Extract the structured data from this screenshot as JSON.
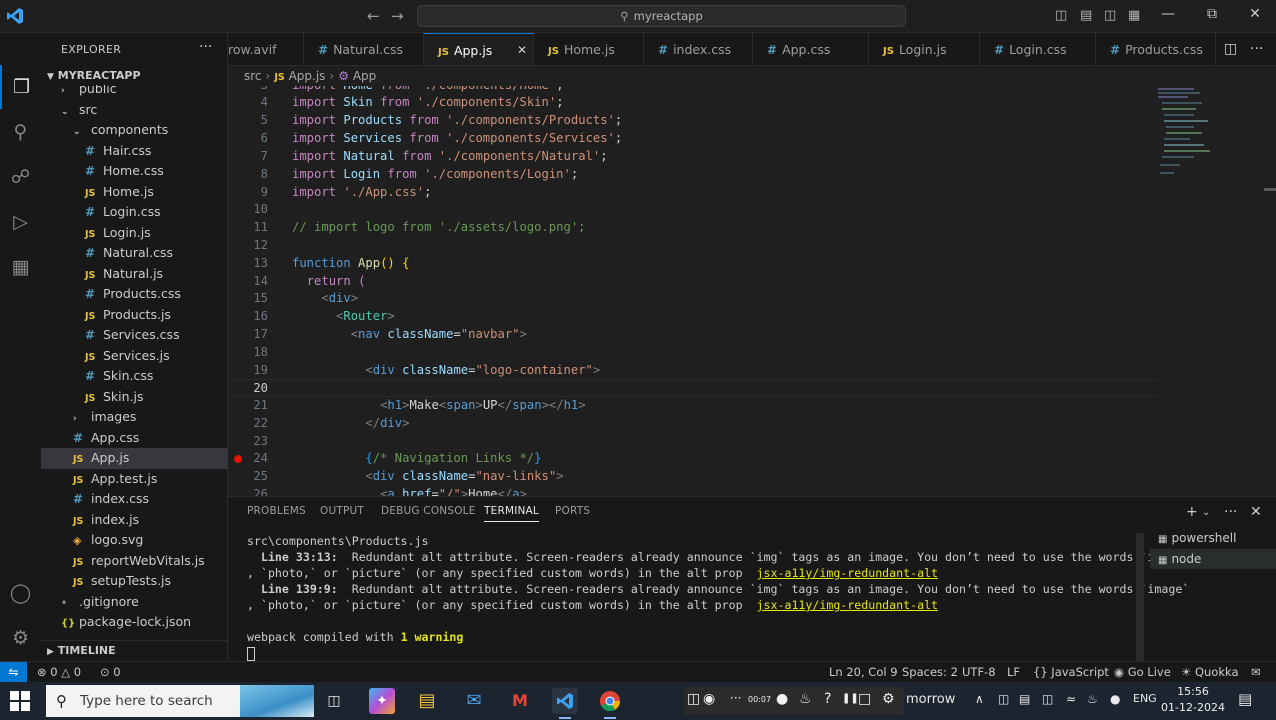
{
  "titlebar": {
    "search_text": "myreactapp"
  },
  "sidebar": {
    "header": "EXPLORER",
    "project": "MYREACTAPP",
    "items": [
      {
        "label": "public",
        "icon": "chevron-right",
        "indent": 1
      },
      {
        "label": "src",
        "icon": "chevron-down",
        "indent": 1
      },
      {
        "label": "components",
        "icon": "chevron-down",
        "indent": 2
      },
      {
        "label": "Hair.css",
        "icon": "css",
        "indent": 3
      },
      {
        "label": "Home.css",
        "icon": "css",
        "indent": 3
      },
      {
        "label": "Home.js",
        "icon": "js",
        "indent": 3
      },
      {
        "label": "Login.css",
        "icon": "css",
        "indent": 3
      },
      {
        "label": "Login.js",
        "icon": "js",
        "indent": 3
      },
      {
        "label": "Natural.css",
        "icon": "css",
        "indent": 3
      },
      {
        "label": "Natural.js",
        "icon": "js",
        "indent": 3
      },
      {
        "label": "Products.css",
        "icon": "css",
        "indent": 3
      },
      {
        "label": "Products.js",
        "icon": "js",
        "indent": 3
      },
      {
        "label": "Services.css",
        "icon": "css",
        "indent": 3
      },
      {
        "label": "Services.js",
        "icon": "js",
        "indent": 3
      },
      {
        "label": "Skin.css",
        "icon": "css",
        "indent": 3
      },
      {
        "label": "Skin.js",
        "icon": "js",
        "indent": 3
      },
      {
        "label": "images",
        "icon": "chevron-right",
        "indent": 2
      },
      {
        "label": "App.css",
        "icon": "css",
        "indent": 2
      },
      {
        "label": "App.js",
        "icon": "js",
        "indent": 2,
        "selected": true
      },
      {
        "label": "App.test.js",
        "icon": "js",
        "indent": 2
      },
      {
        "label": "index.css",
        "icon": "css",
        "indent": 2
      },
      {
        "label": "index.js",
        "icon": "js",
        "indent": 2
      },
      {
        "label": "logo.svg",
        "icon": "svg",
        "indent": 2
      },
      {
        "label": "reportWebVitals.js",
        "icon": "js",
        "indent": 2
      },
      {
        "label": "setupTests.js",
        "icon": "js",
        "indent": 2
      },
      {
        "label": ".gitignore",
        "icon": "gen",
        "indent": 1
      },
      {
        "label": "package-lock.json",
        "icon": "json",
        "indent": 1
      }
    ],
    "timeline": "TIMELINE"
  },
  "tabs": [
    {
      "label": "row.avif",
      "icon": ""
    },
    {
      "label": "Natural.css",
      "icon": "#"
    },
    {
      "label": "App.js",
      "icon": "JS",
      "active": true
    },
    {
      "label": "Home.js",
      "icon": "JS"
    },
    {
      "label": "index.css",
      "icon": "#"
    },
    {
      "label": "App.css",
      "icon": "#"
    },
    {
      "label": "Login.js",
      "icon": "JS"
    },
    {
      "label": "Login.css",
      "icon": "#"
    },
    {
      "label": "Products.css",
      "icon": "#"
    }
  ],
  "breadcrumb": {
    "folder": "src",
    "file": "App.js",
    "symbol": "App"
  },
  "editor": {
    "current_line": 20,
    "breakpoint_line": 24
  },
  "panel": {
    "tabs": [
      "PROBLEMS",
      "OUTPUT",
      "DEBUG CONSOLE",
      "TERMINAL",
      "PORTS"
    ],
    "active_tab": "TERMINAL",
    "terminal_list": [
      "powershell",
      "node"
    ],
    "terminal": {
      "path_line": "src\\components\\Products.js",
      "warn1_loc": "Line 33:13:",
      "warn1_msg": "  Redundant alt attribute. Screen-readers already announce `img` tags as an image. You don’t need to use the words `image`",
      "warn1_cont": ", `photo,` or `picture` (or any specified custom words) in the alt prop  ",
      "warn1_rule": "jsx-a11y/img-redundant-alt",
      "warn2_loc": "Line 139:9:",
      "warn2_msg": "  Redundant alt attribute. Screen-readers already announce `img` tags as an image. You don’t need to use the words `image`",
      "warn2_cont": ", `photo,` or `picture` (or any specified custom words) in the alt prop  ",
      "warn2_rule": "jsx-a11y/img-redundant-alt",
      "compiled_prefix": "webpack compiled with ",
      "compiled_warn": "1 warning"
    }
  },
  "statusbar": {
    "errors": "0",
    "warnings": "0",
    "ports": "0",
    "position": "Ln 20, Col 9",
    "spaces": "Spaces: 2",
    "encoding": "UTF-8",
    "eol": "LF",
    "language": "JavaScript",
    "golive": "Go Live",
    "quokka": "Quokka"
  },
  "taskbar": {
    "search_placeholder": "Type here to search",
    "rec_time": "00:07",
    "weather_text": "morrow",
    "lang": "ENG",
    "time": "15:56",
    "date": "01-12-2024"
  }
}
